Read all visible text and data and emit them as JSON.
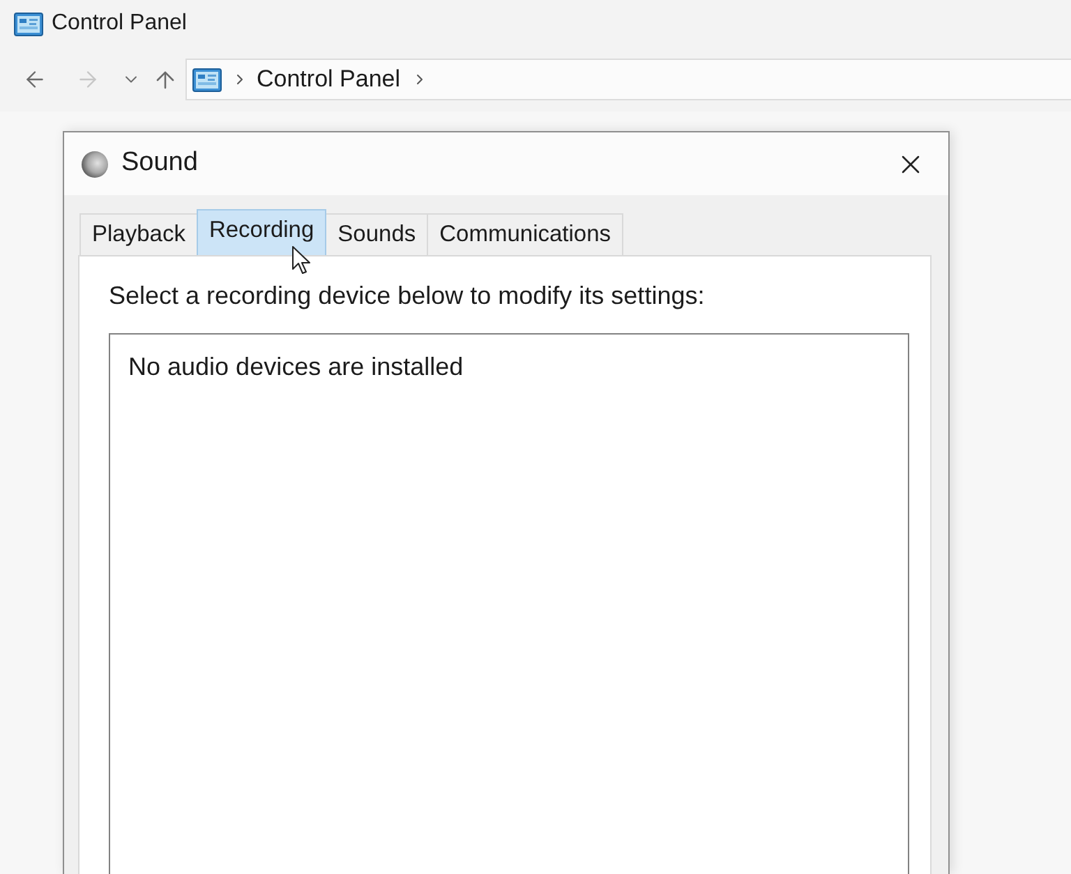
{
  "window": {
    "title": "Control Panel"
  },
  "navigation": {
    "buttons": [
      {
        "kind": "back",
        "disabled": false
      },
      {
        "kind": "forward",
        "disabled": true
      },
      {
        "kind": "recent",
        "disabled": false
      },
      {
        "kind": "up",
        "disabled": false
      }
    ]
  },
  "address_bar": {
    "crumbs": [
      "Control Panel"
    ]
  },
  "dialog": {
    "title": "Sound",
    "tabs": [
      {
        "label": "Playback",
        "selected": false
      },
      {
        "label": "Recording",
        "selected": true
      },
      {
        "label": "Sounds",
        "selected": false
      },
      {
        "label": "Communications",
        "selected": false
      }
    ],
    "instruction": "Select a recording device below to modify its settings:",
    "device_list": {
      "empty_message": "No audio devices are installed"
    }
  }
}
